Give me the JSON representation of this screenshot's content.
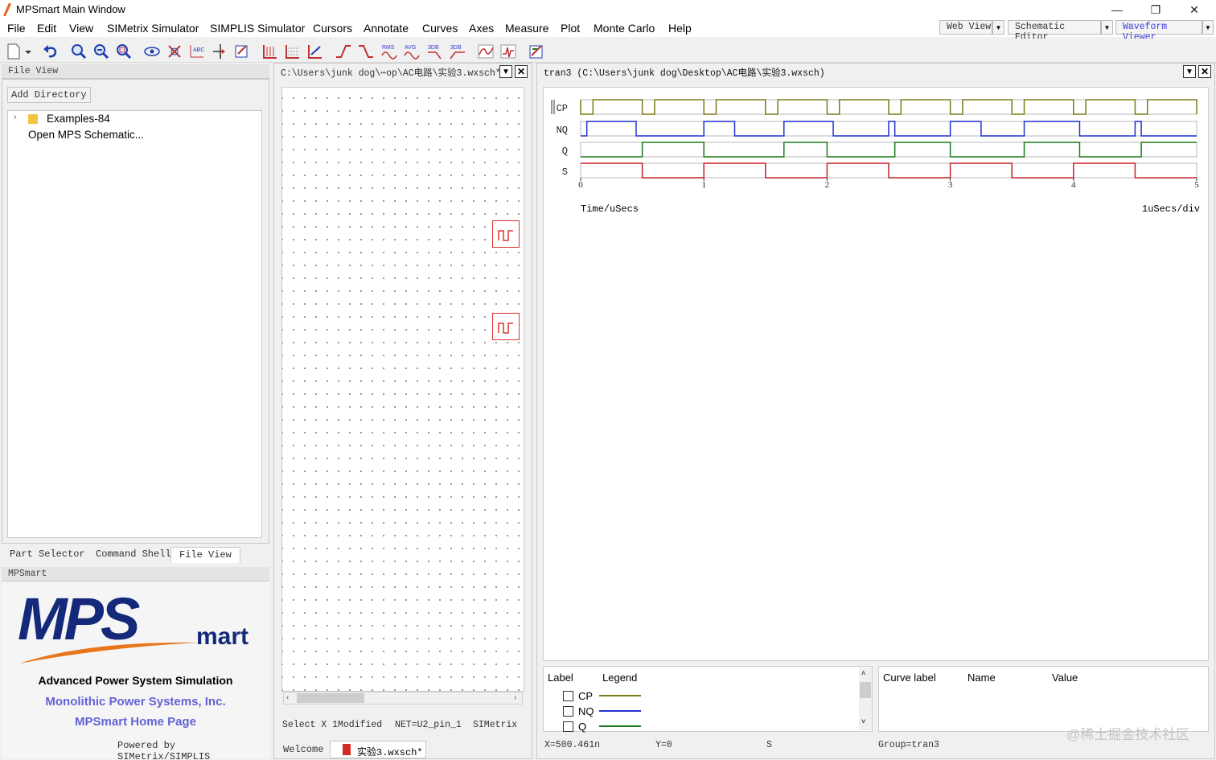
{
  "window": {
    "title": "MPSmart Main Window",
    "minimize": "—",
    "restore": "❐",
    "close": "✕"
  },
  "menu": [
    "File",
    "Edit",
    "View",
    "SIMetrix Simulator",
    "SIMPLIS Simulator",
    "Cursors",
    "Annotate",
    "Curves",
    "Axes",
    "Measure",
    "Plot",
    "Monte Carlo",
    "Help"
  ],
  "views": {
    "web": "Web View",
    "schematic": "Schematic Editor",
    "waveform": "Waveform Viewer"
  },
  "toolbar_labels": {
    "rms": "RMS",
    "avg": "AVG",
    "db1": "3DB",
    "db2": "3DB"
  },
  "left_panel": {
    "header": "File View",
    "add_directory": "Add Directory",
    "tree": [
      {
        "label": "Examples-84",
        "icon": "folder-icon"
      },
      {
        "label": "Open MPS Schematic..."
      }
    ],
    "tabs": [
      "Part Selector",
      "Command Shell",
      "File View"
    ]
  },
  "mps_panel": {
    "header": "MPSmart",
    "logo_main": "MPS",
    "logo_sub": "mart",
    "tagline": "Advanced Power System Simulation",
    "company": "Monolithic Power Systems, Inc.",
    "homepage": "MPSmart Home Page",
    "powered": "Powered by SIMetrix/SIMPLIS"
  },
  "schematic": {
    "title": "C:\\Users\\junk dog\\⋯op\\AC电路\\实验3.wxsch*",
    "status": [
      "Select X 1",
      "Modified",
      "NET=U2_pin_1",
      "SIMetrix"
    ],
    "tabs": [
      "Welcome",
      "实验3.wxsch*"
    ]
  },
  "waveform": {
    "title": "tran3  (C:\\Users\\junk dog\\Desktop\\AC电路\\实验3.wxsch)",
    "status": {
      "x": "X=500.461n",
      "y": "Y=0",
      "s": "S",
      "group": "Group=tran3"
    }
  },
  "chart_data": {
    "type": "line",
    "xlabel": "Time/uSecs",
    "xscale_label": "1uSecs/div",
    "xlim": [
      0,
      5
    ],
    "xticks": [
      "0",
      "1",
      "2",
      "3",
      "4",
      "5"
    ],
    "series": [
      {
        "name": "CP",
        "color": "#7b7b1a",
        "transitions": [
          0,
          0.1,
          0.5,
          0.6,
          1.0,
          1.1,
          1.5,
          1.6,
          2.0,
          2.1,
          2.5,
          2.6,
          3.0,
          3.1,
          3.5,
          3.6,
          4.0,
          4.1,
          4.5,
          4.6,
          5.0
        ],
        "start": 1
      },
      {
        "name": "NQ",
        "color": "#1f2fd0",
        "transitions": [
          0.05,
          0.45,
          1.0,
          1.25,
          1.65,
          2.05,
          2.5,
          2.55,
          3.0,
          3.25,
          3.6,
          4.05,
          4.5,
          4.55
        ],
        "start": 0
      },
      {
        "name": "Q",
        "color": "#1a7a1a",
        "transitions": [
          0.5,
          1.0,
          1.65,
          2.0,
          2.55,
          3.0,
          3.6,
          4.05,
          4.55
        ],
        "start": 0
      },
      {
        "name": "S",
        "color": "#c8202a",
        "transitions": [
          0.5,
          1.0,
          1.5,
          2.0,
          2.5,
          3.0,
          3.5,
          4.0,
          4.5
        ],
        "start": 1
      }
    ]
  },
  "legend": {
    "col_label": "Label",
    "col_legend": "Legend",
    "items": [
      {
        "name": "CP",
        "color": "#7b7b1a"
      },
      {
        "name": "NQ",
        "color": "#1f2fd0"
      },
      {
        "name": "Q",
        "color": "#1a7a1a"
      }
    ]
  },
  "curve_panel": {
    "col_curve": "Curve label",
    "col_name": "Name",
    "col_value": "Value"
  },
  "watermark": "@稀土掘金技术社区"
}
